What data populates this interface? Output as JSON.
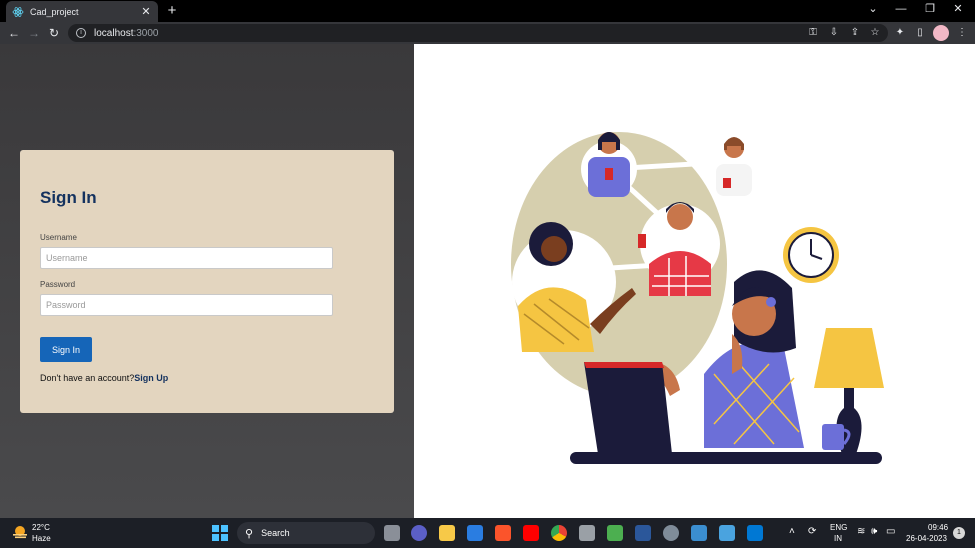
{
  "browser": {
    "tab_title": "Cad_project",
    "new_tab_symbol": "+",
    "close_symbol": "✕",
    "url_host": "localhost",
    "url_port": ":3000"
  },
  "login": {
    "title": "Sign In",
    "username_label": "Username",
    "username_placeholder": "Username",
    "password_label": "Password",
    "password_placeholder": "Password",
    "submit_label": "Sign In",
    "no_account_text": "Don't have an account?",
    "signup_link": "Sign Up"
  },
  "taskbar": {
    "temperature": "22°C",
    "weather": "Haze",
    "search_label": "Search",
    "language": "ENG",
    "region": "IN",
    "time": "09:46",
    "date": "26-04-2023",
    "notification_count": "1"
  },
  "colors": {
    "card_bg": "#e3d5bf",
    "title_color": "#14325f",
    "button_bg": "#1565b8"
  }
}
